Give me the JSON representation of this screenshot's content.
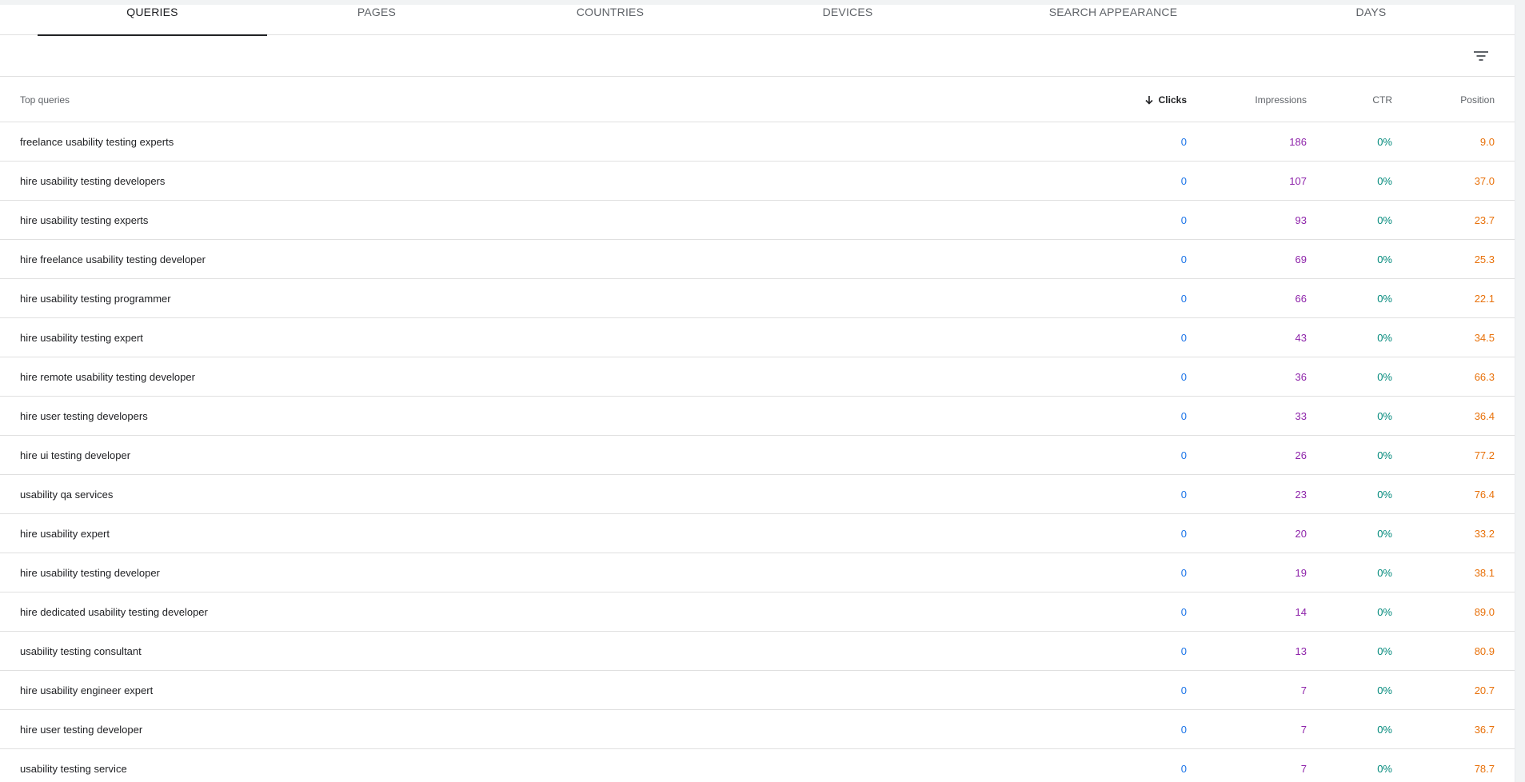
{
  "tabs": [
    {
      "label": "QUERIES",
      "active": true
    },
    {
      "label": "PAGES",
      "active": false
    },
    {
      "label": "COUNTRIES",
      "active": false
    },
    {
      "label": "DEVICES",
      "active": false
    },
    {
      "label": "SEARCH APPEARANCE",
      "active": false
    },
    {
      "label": "DAYS",
      "active": false
    }
  ],
  "toolbar": {
    "filter_icon": "filter-list-icon"
  },
  "table": {
    "headers": {
      "query": "Top queries",
      "clicks": "Clicks",
      "impressions": "Impressions",
      "ctr": "CTR",
      "position": "Position"
    },
    "sort": {
      "column": "clicks",
      "direction": "descending",
      "icon": "arrow-down-icon"
    },
    "colors": {
      "clicks": "#1a73e8",
      "impressions": "#8e24aa",
      "ctr": "#00897b",
      "position": "#e8710a"
    },
    "rows": [
      {
        "query": "freelance usability testing experts",
        "clicks": "0",
        "impressions": "186",
        "ctr": "0%",
        "position": "9.0"
      },
      {
        "query": "hire usability testing developers",
        "clicks": "0",
        "impressions": "107",
        "ctr": "0%",
        "position": "37.0"
      },
      {
        "query": "hire usability testing experts",
        "clicks": "0",
        "impressions": "93",
        "ctr": "0%",
        "position": "23.7"
      },
      {
        "query": "hire freelance usability testing developer",
        "clicks": "0",
        "impressions": "69",
        "ctr": "0%",
        "position": "25.3"
      },
      {
        "query": "hire usability testing programmer",
        "clicks": "0",
        "impressions": "66",
        "ctr": "0%",
        "position": "22.1"
      },
      {
        "query": "hire usability testing expert",
        "clicks": "0",
        "impressions": "43",
        "ctr": "0%",
        "position": "34.5"
      },
      {
        "query": "hire remote usability testing developer",
        "clicks": "0",
        "impressions": "36",
        "ctr": "0%",
        "position": "66.3"
      },
      {
        "query": "hire user testing developers",
        "clicks": "0",
        "impressions": "33",
        "ctr": "0%",
        "position": "36.4"
      },
      {
        "query": "hire ui testing developer",
        "clicks": "0",
        "impressions": "26",
        "ctr": "0%",
        "position": "77.2"
      },
      {
        "query": "usability qa services",
        "clicks": "0",
        "impressions": "23",
        "ctr": "0%",
        "position": "76.4"
      },
      {
        "query": "hire usability expert",
        "clicks": "0",
        "impressions": "20",
        "ctr": "0%",
        "position": "33.2"
      },
      {
        "query": "hire usability testing developer",
        "clicks": "0",
        "impressions": "19",
        "ctr": "0%",
        "position": "38.1"
      },
      {
        "query": "hire dedicated usability testing developer",
        "clicks": "0",
        "impressions": "14",
        "ctr": "0%",
        "position": "89.0"
      },
      {
        "query": "usability testing consultant",
        "clicks": "0",
        "impressions": "13",
        "ctr": "0%",
        "position": "80.9"
      },
      {
        "query": "hire usability engineer expert",
        "clicks": "0",
        "impressions": "7",
        "ctr": "0%",
        "position": "20.7"
      },
      {
        "query": "hire user testing developer",
        "clicks": "0",
        "impressions": "7",
        "ctr": "0%",
        "position": "36.7"
      },
      {
        "query": "usability testing service",
        "clicks": "0",
        "impressions": "7",
        "ctr": "0%",
        "position": "78.7"
      }
    ]
  }
}
